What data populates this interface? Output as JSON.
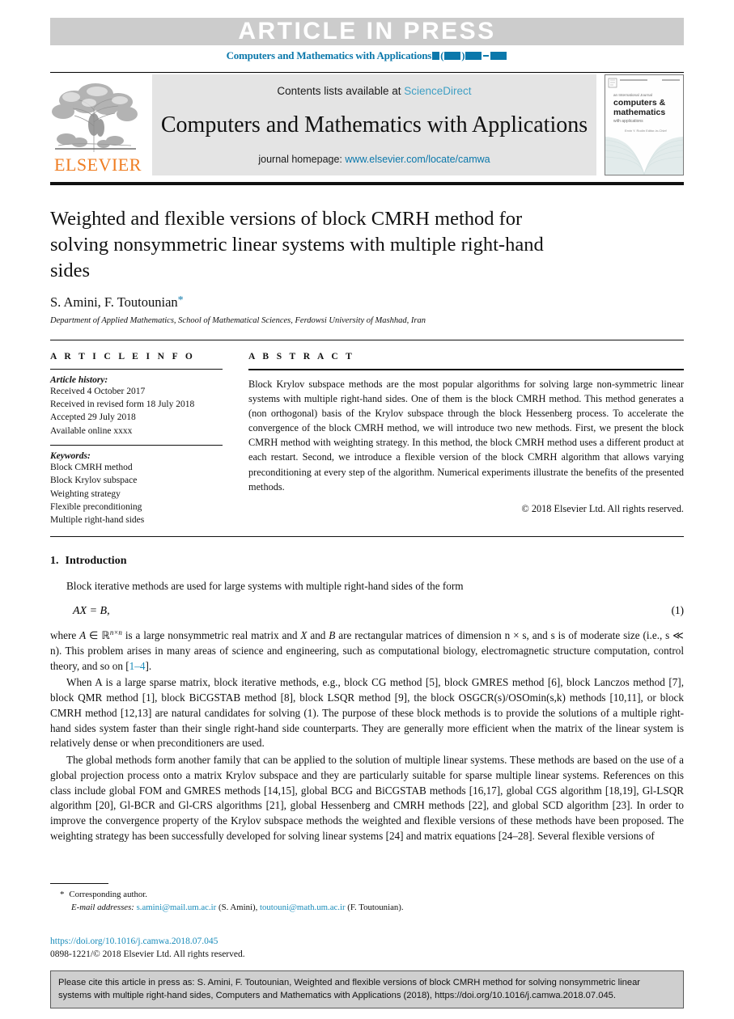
{
  "press_banner": {
    "label": "ARTICLE IN PRESS",
    "journal_ref_prefix": "Computers and Mathematics with Applications"
  },
  "masthead": {
    "contents_prefix": "Contents lists available at",
    "sciencedirect": "ScienceDirect",
    "journal_title": "Computers and Mathematics with Applications",
    "homepage_prefix": "journal homepage:",
    "homepage_url": "www.elsevier.com/locate/camwa",
    "publisher": "ELSEVIER",
    "cover": {
      "line1": "an International Journal",
      "line2": "computers &",
      "line3": "mathematics",
      "line4": "with applications",
      "line5": "Ervin Y. Rodin   Editor-in-Chief"
    }
  },
  "title_block": {
    "title": "Weighted and flexible versions of block CMRH method for solving nonsymmetric linear systems with multiple right-hand sides",
    "authors": "S. Amini, F. Toutounian",
    "corresponding_marker": "*",
    "affiliation": "Department of Applied Mathematics, School of Mathematical Sciences, Ferdowsi University of Mashhad, Iran"
  },
  "article_info": {
    "heading": "A R T I C L E   I N F O",
    "history_heading": "Article history:",
    "history": [
      "Received 4 October 2017",
      "Received in revised form 18 July 2018",
      "Accepted 29 July 2018",
      "Available online xxxx"
    ],
    "keywords_heading": "Keywords:",
    "keywords": [
      "Block CMRH method",
      "Block Krylov subspace",
      "Weighting strategy",
      "Flexible preconditioning",
      "Multiple right-hand sides"
    ]
  },
  "abstract": {
    "heading": "A B S T R A C T",
    "text": "Block Krylov subspace methods are the most popular algorithms for solving large non-symmetric linear systems with multiple right-hand sides. One of them is the block CMRH method. This method generates a (non orthogonal) basis of the Krylov subspace through the block Hessenberg process. To accelerate the convergence of the block CMRH method, we will introduce two new methods. First, we present the block CMRH method with weighting strategy. In this method, the block CMRH method uses a different product at each restart. Second, we introduce a flexible version of the block CMRH algorithm that allows varying preconditioning at every step of the algorithm. Numerical experiments illustrate the benefits of the presented methods.",
    "copyright": "© 2018 Elsevier Ltd. All rights reserved."
  },
  "introduction": {
    "section_number": "1.",
    "section_title": "Introduction",
    "para1": "Block iterative methods are used for large systems with multiple right-hand sides of the form",
    "equation": "AX = B,",
    "equation_number": "(1)",
    "para2_a": "where ",
    "para2_A": "A",
    "para2_b": " ∈ ",
    "para2_R": "ℝ",
    "para2_Rsup": "n×n",
    "para2_c": " is a large nonsymmetric real matrix and ",
    "para2_X": "X",
    "para2_d": " and ",
    "para2_B": "B",
    "para2_e": " are rectangular matrices of dimension n × s, and s is of moderate size (i.e., s ≪ n). This problem arises in many areas of science and engineering, such as computational biology, electromagnetic structure computation, control theory, and so on [",
    "para2_ref": "1–4",
    "para2_f": "].",
    "para3": "When A is a large sparse matrix, block iterative methods, e.g., block CG method [5], block GMRES method [6], block Lanczos method [7], block QMR method [1], block BiCGSTAB method [8], block LSQR method [9], the block OSGCR(s)/OSOmin(s,k) methods [10,11], or block CMRH method [12,13] are natural candidates for solving (1). The purpose of these block methods is to provide the solutions of a multiple right-hand sides system faster than their single right-hand side counterparts. They are generally more efficient when the matrix of the linear system is relatively dense or when preconditioners are used.",
    "para4": "The global methods form another family that can be applied to the solution of multiple linear systems. These methods are based on the use of a global projection process onto a matrix Krylov subspace and they are particularly suitable for sparse multiple linear systems. References on this class include global FOM and GMRES methods [14,15], global BCG and BiCGSTAB methods [16,17], global CGS algorithm [18,19], Gl-LSQR algorithm [20], Gl-BCR and Gl-CRS algorithms [21], global Hessenberg and CMRH methods [22], and global SCD algorithm [23]. In order to improve the convergence property of the Krylov subspace methods the weighted and flexible versions of these methods have been proposed. The weighting strategy has been successfully developed for solving linear systems [24] and matrix equations [24–28]. Several flexible versions of"
  },
  "footnotes": {
    "corresponding_star": "*",
    "corresponding_text": "Corresponding author.",
    "email_label": "E-mail addresses:",
    "email1": "s.amini@mail.um.ac.ir",
    "email1_name": "(S. Amini),",
    "email2": "toutouni@math.um.ac.ir",
    "email2_name": "(F. Toutounian)."
  },
  "doi_block": {
    "doi": "https://doi.org/10.1016/j.camwa.2018.07.045",
    "issn": "0898-1221/© 2018 Elsevier Ltd. All rights reserved."
  },
  "citation_box": {
    "text": "Please cite this article in press as: S. Amini, F. Toutounian, Weighted and flexible versions of block CMRH method for solving nonsymmetric linear systems with multiple right-hand sides, Computers and Mathematics with Applications (2018), https://doi.org/10.1016/j.camwa.2018.07.045."
  },
  "colors": {
    "link_blue": "#0b78ab",
    "ref_blue": "#1a8cba",
    "sciencedirect_blue": "#3f9fc4",
    "elsevier_orange": "#ef7d22",
    "banner_gray": "#cccccc",
    "masthead_gray": "#e4e4e4",
    "cite_gray": "#cfcfcf"
  }
}
